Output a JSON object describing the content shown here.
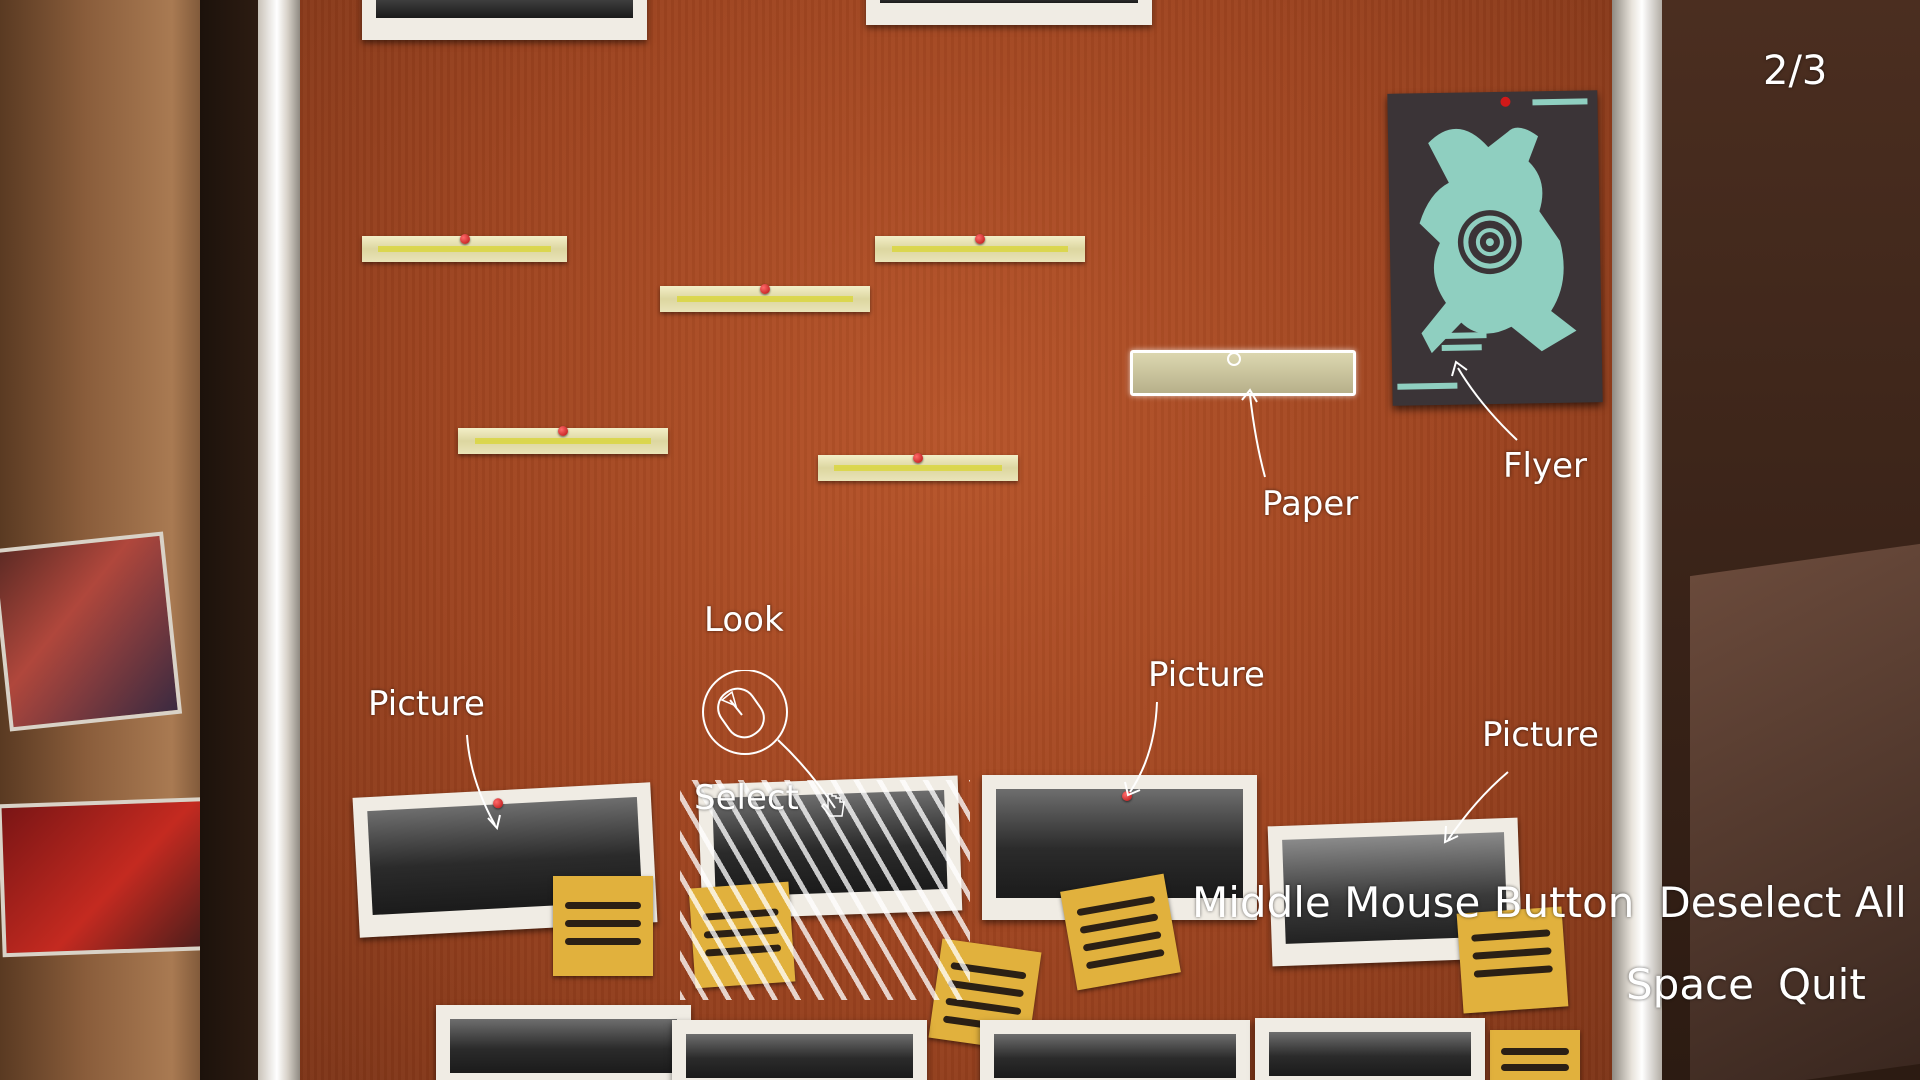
{
  "page_indicator": "2/3",
  "labels": {
    "paper": "Paper",
    "flyer": "Flyer",
    "look": "Look",
    "select": "Select",
    "picture": "Picture"
  },
  "controls": [
    {
      "key": "Middle Mouse Button",
      "action": "Deselect All"
    },
    {
      "key": "Space",
      "action": "Quit"
    }
  ],
  "icons": {
    "mouse": "mouse-icon",
    "cursor": "hand-cursor-icon"
  },
  "colors": {
    "board": "#a94b23",
    "label_text": "#ffffff",
    "sticky_note": "#e1b13d",
    "pin": "#d01919",
    "flyer_art": "#8fcfc0"
  }
}
